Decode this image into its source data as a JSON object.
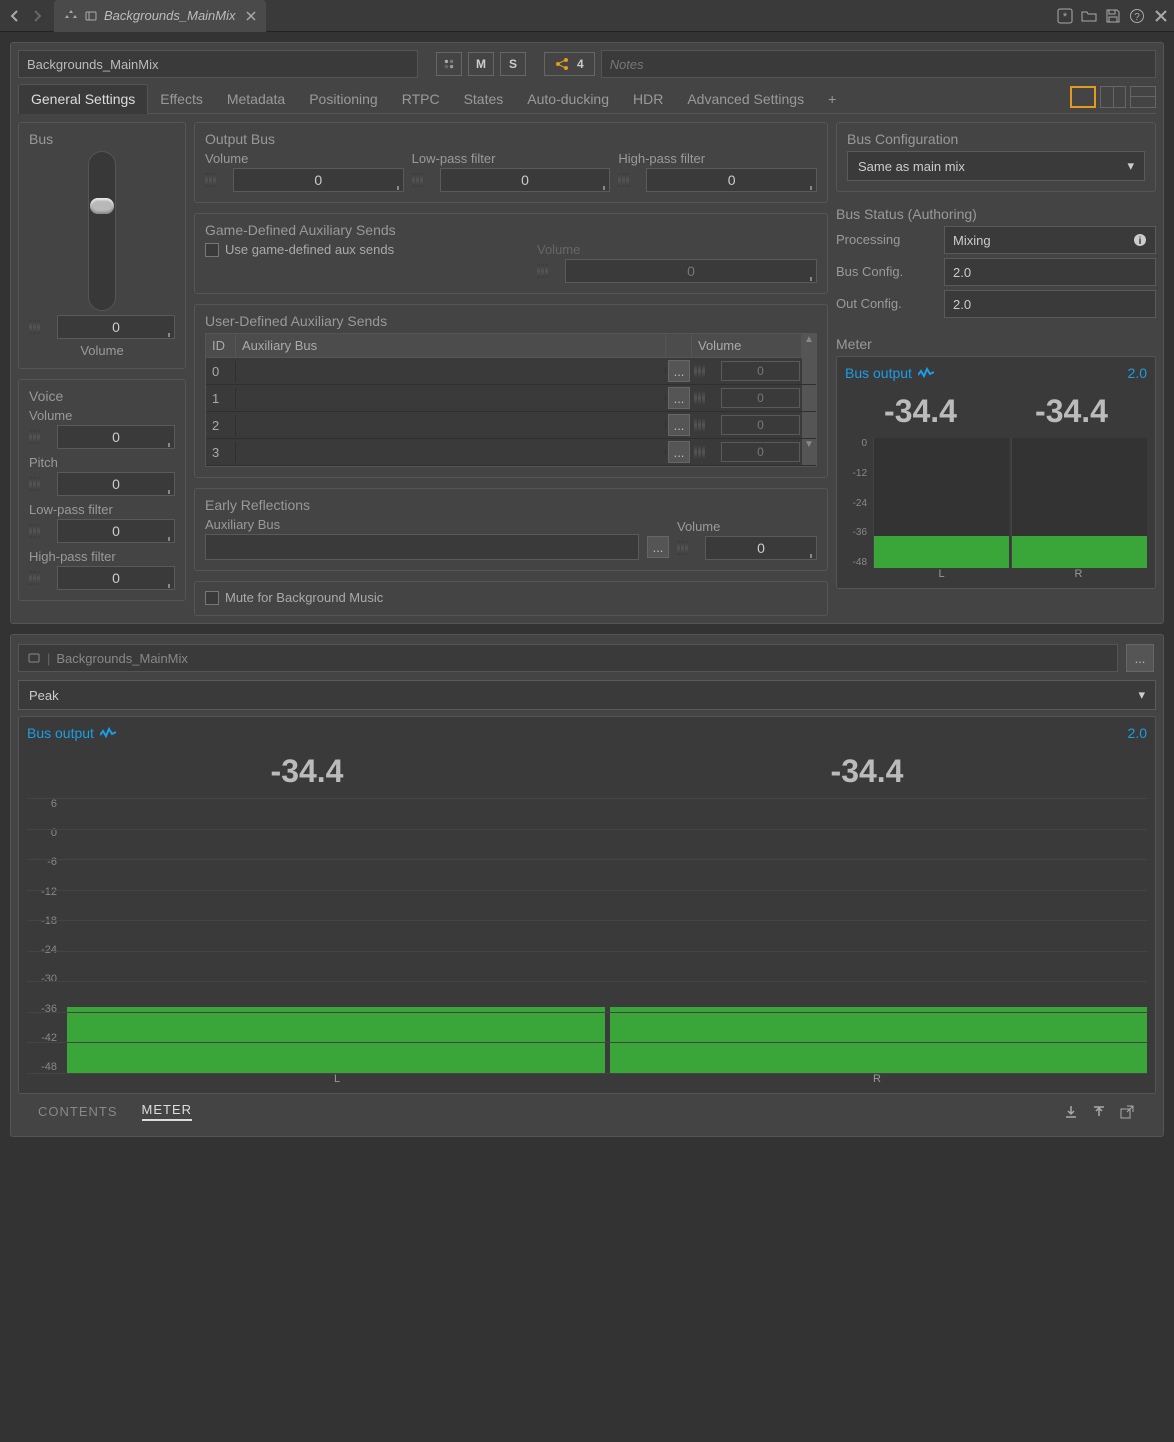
{
  "nav": {
    "tab_title": "Backgrounds_MainMix"
  },
  "header": {
    "name": "Backgrounds_MainMix",
    "mute_label": "M",
    "solo_label": "S",
    "routing_count": "4",
    "notes_placeholder": "Notes"
  },
  "tabs": {
    "general": "General Settings",
    "effects": "Effects",
    "metadata": "Metadata",
    "positioning": "Positioning",
    "rtpc": "RTPC",
    "states": "States",
    "autoducking": "Auto-ducking",
    "hdr": "HDR",
    "advanced": "Advanced Settings",
    "plus": "+"
  },
  "bus_panel": {
    "title": "Bus",
    "volume_label": "Volume",
    "volume": "0"
  },
  "voice_panel": {
    "title": "Voice",
    "volume_label": "Volume",
    "volume": "0",
    "pitch_label": "Pitch",
    "pitch": "0",
    "lpf_label": "Low-pass filter",
    "lpf": "0",
    "hpf_label": "High-pass filter",
    "hpf": "0"
  },
  "output_bus": {
    "title": "Output Bus",
    "volume_label": "Volume",
    "volume": "0",
    "lpf_label": "Low-pass filter",
    "lpf": "0",
    "hpf_label": "High-pass filter",
    "hpf": "0"
  },
  "game_aux": {
    "title": "Game-Defined Auxiliary Sends",
    "checkbox_label": "Use game-defined aux sends",
    "volume_label": "Volume",
    "volume": "0"
  },
  "user_aux": {
    "title": "User-Defined Auxiliary Sends",
    "h_id": "ID",
    "h_bus": "Auxiliary Bus",
    "h_vol": "Volume",
    "rows": [
      {
        "id": "0",
        "vol": "0"
      },
      {
        "id": "1",
        "vol": "0"
      },
      {
        "id": "2",
        "vol": "0"
      },
      {
        "id": "3",
        "vol": "0"
      }
    ]
  },
  "early_refl": {
    "title": "Early Reflections",
    "bus_label": "Auxiliary Bus",
    "volume_label": "Volume",
    "volume": "0"
  },
  "mute_bg": {
    "label": "Mute for Background Music"
  },
  "bus_config": {
    "title": "Bus Configuration",
    "selected": "Same as main mix"
  },
  "bus_status": {
    "title": "Bus Status (Authoring)",
    "processing_label": "Processing",
    "processing": "Mixing",
    "busconf_label": "Bus Config.",
    "busconf": "2.0",
    "outconf_label": "Out Config.",
    "outconf": "2.0"
  },
  "meter_small": {
    "title": "Meter",
    "head_label": "Bus output",
    "head_right": "2.0",
    "val_l": "-34.4",
    "val_r": "-34.4",
    "axis": [
      "0",
      "-12",
      "-24",
      "-36",
      "-48"
    ],
    "lab_l": "L",
    "lab_r": "R",
    "fill_pct": 25
  },
  "lower": {
    "name": "Backgrounds_MainMix",
    "mode": "Peak",
    "head_label": "Bus output",
    "head_right": "2.0",
    "val_l": "-34.4",
    "val_r": "-34.4",
    "axis": [
      "6",
      "0",
      "-6",
      "-12",
      "-18",
      "-24",
      "-30",
      "-36",
      "-42",
      "-48"
    ],
    "lab_l": "L",
    "lab_r": "R",
    "fill_pct": 24
  },
  "footer": {
    "contents": "CONTENTS",
    "meter": "METER"
  }
}
